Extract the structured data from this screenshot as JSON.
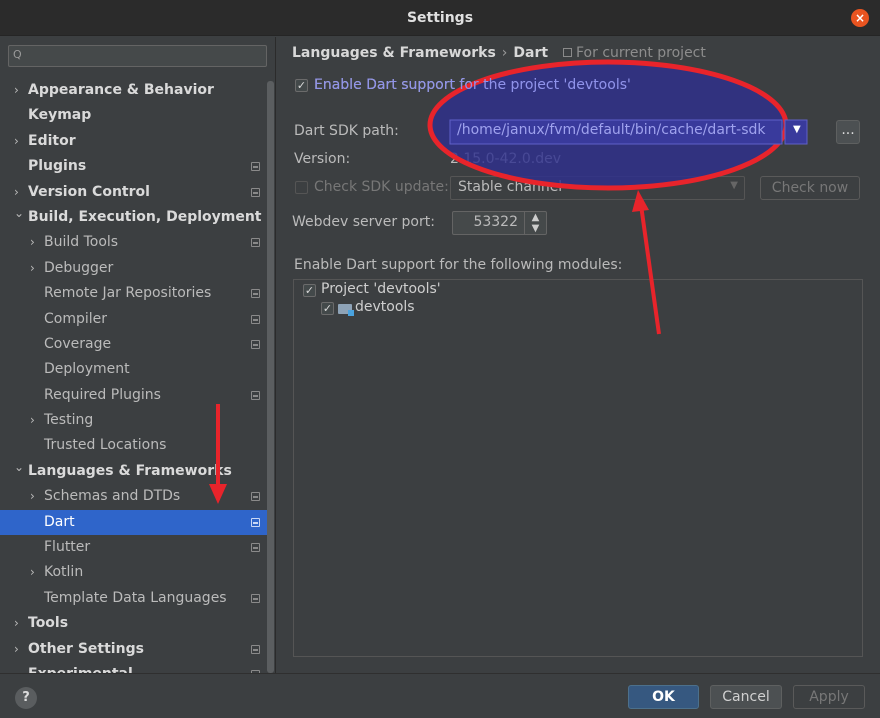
{
  "window": {
    "title": "Settings",
    "close_glyph": "×"
  },
  "search": {
    "placeholder": "",
    "icon": "search-icon",
    "glyph": "Q"
  },
  "sidebar": {
    "items": [
      {
        "label": "Appearance & Behavior",
        "expandable": true,
        "expanded": false,
        "bold": true,
        "level": 0,
        "project_icon": false
      },
      {
        "label": "Keymap",
        "expandable": false,
        "bold": true,
        "level": 0,
        "project_icon": false
      },
      {
        "label": "Editor",
        "expandable": true,
        "expanded": false,
        "bold": true,
        "level": 0,
        "project_icon": false
      },
      {
        "label": "Plugins",
        "expandable": false,
        "bold": true,
        "level": 0,
        "project_icon": true
      },
      {
        "label": "Version Control",
        "expandable": true,
        "expanded": false,
        "bold": true,
        "level": 0,
        "project_icon": true
      },
      {
        "label": "Build, Execution, Deployment",
        "expandable": true,
        "expanded": true,
        "bold": true,
        "level": 0,
        "project_icon": false
      },
      {
        "label": "Build Tools",
        "expandable": true,
        "expanded": false,
        "bold": false,
        "level": 1,
        "project_icon": true
      },
      {
        "label": "Debugger",
        "expandable": true,
        "expanded": false,
        "bold": false,
        "level": 1,
        "project_icon": false
      },
      {
        "label": "Remote Jar Repositories",
        "expandable": false,
        "bold": false,
        "level": 1,
        "project_icon": true
      },
      {
        "label": "Compiler",
        "expandable": false,
        "bold": false,
        "level": 1,
        "project_icon": true
      },
      {
        "label": "Coverage",
        "expandable": false,
        "bold": false,
        "level": 1,
        "project_icon": true
      },
      {
        "label": "Deployment",
        "expandable": false,
        "bold": false,
        "level": 1,
        "project_icon": false
      },
      {
        "label": "Required Plugins",
        "expandable": false,
        "bold": false,
        "level": 1,
        "project_icon": true
      },
      {
        "label": "Testing",
        "expandable": true,
        "expanded": false,
        "bold": false,
        "level": 1,
        "project_icon": false
      },
      {
        "label": "Trusted Locations",
        "expandable": false,
        "bold": false,
        "level": 1,
        "project_icon": false
      },
      {
        "label": "Languages & Frameworks",
        "expandable": true,
        "expanded": true,
        "bold": true,
        "level": 0,
        "project_icon": false
      },
      {
        "label": "Schemas and DTDs",
        "expandable": true,
        "expanded": false,
        "bold": false,
        "level": 1,
        "project_icon": true
      },
      {
        "label": "Dart",
        "expandable": false,
        "bold": false,
        "level": 1,
        "project_icon": true,
        "selected": true
      },
      {
        "label": "Flutter",
        "expandable": false,
        "bold": false,
        "level": 1,
        "project_icon": true
      },
      {
        "label": "Kotlin",
        "expandable": true,
        "expanded": false,
        "bold": false,
        "level": 1,
        "project_icon": false
      },
      {
        "label": "Template Data Languages",
        "expandable": false,
        "bold": false,
        "level": 1,
        "project_icon": true
      },
      {
        "label": "Tools",
        "expandable": true,
        "expanded": false,
        "bold": true,
        "level": 0,
        "project_icon": false
      },
      {
        "label": "Other Settings",
        "expandable": true,
        "expanded": false,
        "bold": true,
        "level": 0,
        "project_icon": true
      },
      {
        "label": "Experimental",
        "expandable": false,
        "bold": true,
        "level": 0,
        "project_icon": true
      }
    ]
  },
  "breadcrumb": {
    "parent": "Languages & Frameworks",
    "separator": "›",
    "current": "Dart"
  },
  "scope_label": "For current project",
  "dart": {
    "enable_label": "Enable Dart support for the project 'devtools'",
    "enable_checked": true,
    "sdk_path_label": "Dart SDK path:",
    "sdk_path_value": "/home/janux/fvm/default/bin/cache/dart-sdk",
    "more_button": "...",
    "version_label": "Version:",
    "version_value": "2.15.0-42.0.dev",
    "check_sdk_label": "Check SDK update:",
    "check_sdk_checked": false,
    "channel_value": "Stable channel",
    "check_now_label": "Check now",
    "webdev_label": "Webdev server port:",
    "webdev_port": "53322",
    "modules_label": "Enable Dart support for the following modules:",
    "modules": [
      {
        "label": "Project 'devtools'",
        "checked": true
      },
      {
        "label": "devtools",
        "checked": true
      }
    ]
  },
  "buttons": {
    "help": "?",
    "ok": "OK",
    "cancel": "Cancel",
    "apply": "Apply"
  },
  "colors": {
    "selection": "#2f65ca",
    "annotation_red": "#e8242b",
    "highlight_blue": "#2e2f8e",
    "close_orange": "#e95420"
  }
}
